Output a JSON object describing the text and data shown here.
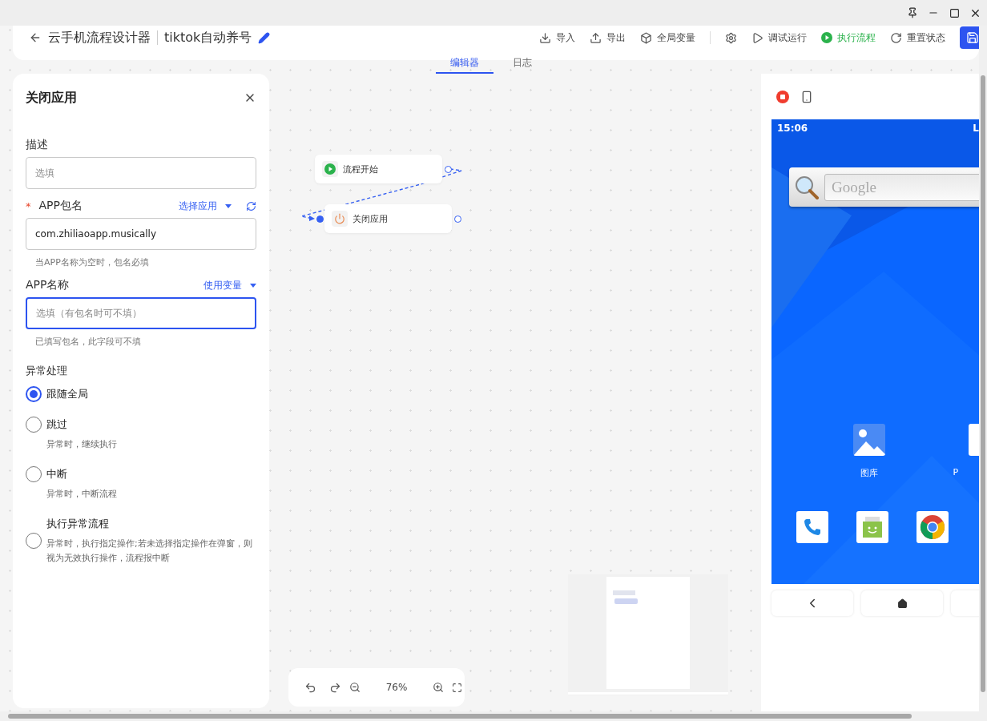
{
  "header": {
    "title": "云手机流程设计器",
    "project": "tiktok自动养号",
    "actions": [
      {
        "kind": "import",
        "label": "导入"
      },
      {
        "kind": "export",
        "label": "导出"
      },
      {
        "kind": "variables",
        "label": "全局变量"
      },
      {
        "kind": "settings"
      },
      {
        "kind": "debug",
        "label": "调试运行"
      },
      {
        "kind": "run",
        "label": "执行流程"
      },
      {
        "kind": "reset",
        "label": "重置状态"
      },
      {
        "kind": "save"
      }
    ]
  },
  "tabs": [
    {
      "label": "编辑器",
      "selected": true
    },
    {
      "label": "日志",
      "selected": false
    }
  ],
  "panel": {
    "title": "关闭应用",
    "fields": [
      {
        "label": "描述",
        "placeholder": "选填",
        "focused": false
      },
      {
        "marker": "*",
        "label": "APP包名",
        "link": "选择应用",
        "refresh": true,
        "value": "com.zhiliaoapp.musically",
        "hint": "当APP名称为空时，包名必填",
        "focused": false
      },
      {
        "label": "APP名称",
        "link": "使用变量",
        "placeholder": "选填（有包名时可不填）",
        "hint": "已填写包名，此字段可不填",
        "focused": true
      }
    ],
    "exception": {
      "label": "异常处理",
      "options": [
        {
          "label": "跟随全局",
          "selected": true
        },
        {
          "label": "跳过",
          "desc": "异常时，继续执行",
          "selected": false
        },
        {
          "label": "中断",
          "desc": "异常时，中断流程",
          "selected": false
        },
        {
          "label": "执行异常流程",
          "desc": "异常时，执行指定操作;若未选择指定操作在弹窗，则视为无效执行操作，流程报中断",
          "selected": false
        }
      ]
    }
  },
  "canvas": {
    "nodes": [
      {
        "kind": "start",
        "label": "流程开始"
      },
      {
        "kind": "close",
        "label": "关闭应用"
      }
    ],
    "zoom": "76%"
  },
  "phone": {
    "time": "15:06",
    "status": "L",
    "search_placeholder": "Google",
    "apps": [
      {
        "kind": "gallery",
        "label": "图库"
      },
      {
        "kind": "partial",
        "label": "P"
      }
    ],
    "dock": [
      {
        "kind": "phone"
      },
      {
        "kind": "messages"
      },
      {
        "kind": "chrome"
      }
    ]
  }
}
